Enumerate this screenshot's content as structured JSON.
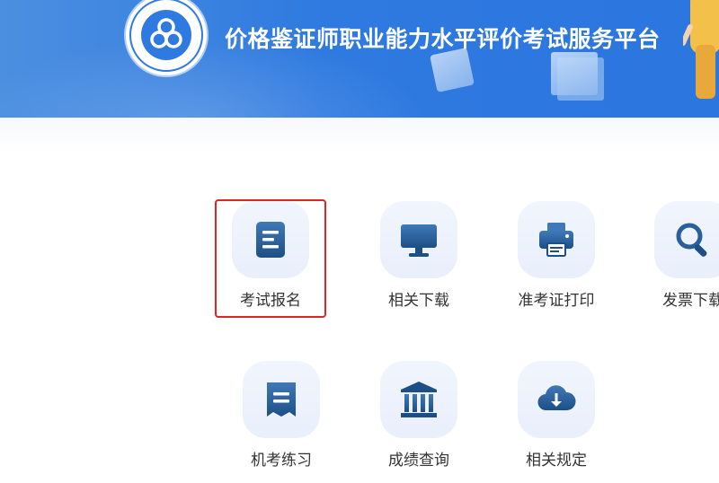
{
  "header": {
    "title": "价格鉴证师职业能力水平评价考试服务平台",
    "logo_icon": "price-association-logo",
    "banner_color": "#2f7ae0"
  },
  "services": [
    {
      "label": "考试报名",
      "icon": "document-icon",
      "selected": true
    },
    {
      "label": "相关下载",
      "icon": "monitor-icon",
      "selected": false
    },
    {
      "label": "准考证打印",
      "icon": "printer-icon",
      "selected": false
    },
    {
      "label": "发票下载",
      "icon": "search-icon",
      "selected": false
    },
    {
      "label": "机考练习",
      "icon": "receipt-icon",
      "selected": false
    },
    {
      "label": "成绩查询",
      "icon": "bank-icon",
      "selected": false
    },
    {
      "label": "相关规定",
      "icon": "cloud-download-icon",
      "selected": false
    }
  ],
  "colors": {
    "icon_dark": "#1d4f86",
    "icon_light": "#3f79b8",
    "selection_outline": "#e02424",
    "label_text": "#333333"
  }
}
